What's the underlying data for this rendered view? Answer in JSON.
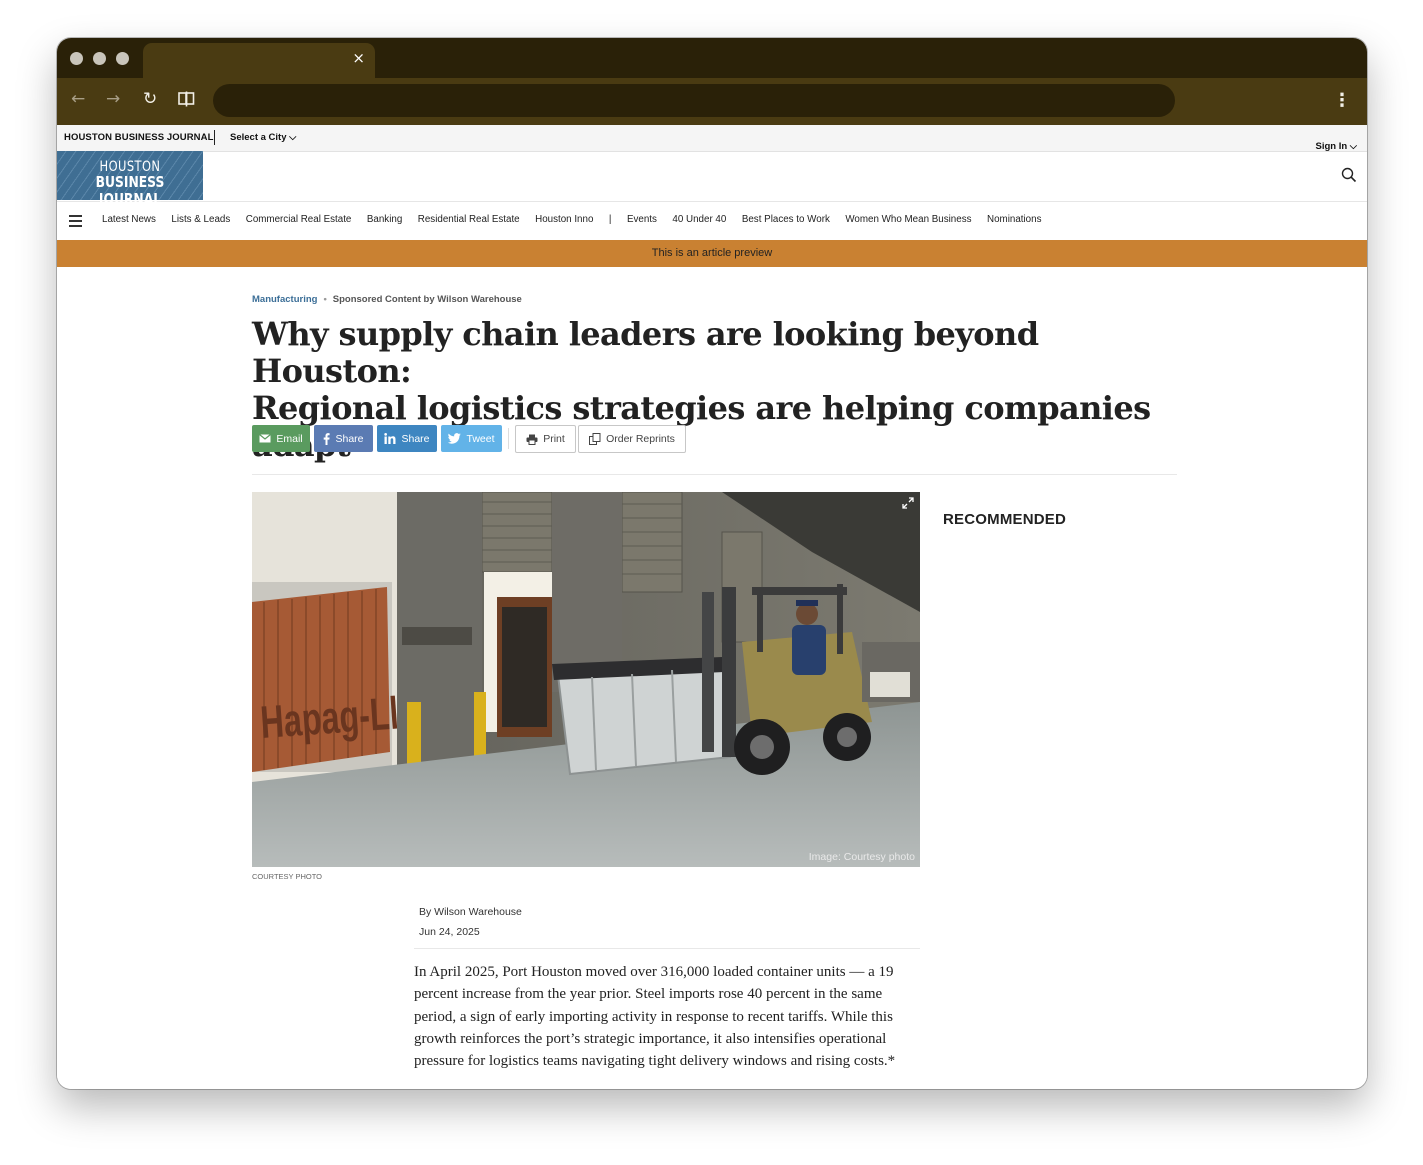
{
  "browser": {
    "tab_close": "×",
    "back": "←",
    "forward": "→",
    "reload": "↻",
    "menu": "⋮"
  },
  "topbar": {
    "brand": "HOUSTON BUSINESS JOURNAL",
    "city_select": "Select a City ⌵",
    "sign_in": "Sign In ⌵"
  },
  "header": {
    "logo_top": "HOUSTON",
    "logo_bottom": "BUSINESS JOURNAL"
  },
  "nav": {
    "items": [
      "Latest News",
      "Lists & Leads",
      "Commercial Real Estate",
      "Banking",
      "Residential Real Estate",
      "Houston Inno",
      "|",
      "Events",
      "40 Under 40",
      "Best Places to Work",
      "Women Who Mean Business",
      "Nominations"
    ]
  },
  "banner": {
    "text": "This is an article preview"
  },
  "article": {
    "category": "Manufacturing",
    "kicker_dot": "•",
    "sponsor": "Sponsored Content by Wilson Warehouse",
    "headline_line1": "Why supply chain leaders are looking beyond Houston:",
    "headline_line2": "Regional logistics strategies are helping companies adapt",
    "share": {
      "email": "Email",
      "facebook": "Share",
      "linkedin": "Share",
      "twitter": "Tweet",
      "print": "Print",
      "reprints": "Order Reprints"
    },
    "photo_overlay": "Image: Courtesy photo",
    "container_text": "Hapag-Lloyd",
    "photo_credit": "COURTESY PHOTO",
    "byline": "By Wilson Warehouse",
    "date": "Jun 24, 2025",
    "body": "In April 2025, Port Houston moved over 316,000 loaded container units — a 19 percent increase from the year prior. Steel imports rose 40 percent in the same period, a sign of early importing activity in response to recent tariffs. While this growth reinforces the port’s strategic importance, it also intensifies operational pressure for logistics teams navigating tight delivery windows and rising costs.*"
  },
  "sidebar": {
    "recommended": "RECOMMENDED"
  },
  "colors": {
    "chrome_dark": "#2a2108",
    "chrome_toolbar": "#4a3b12",
    "banner": "#c98132",
    "category_link": "#3b6e97",
    "email": "#5a9b5f",
    "facebook": "#5b7bb3",
    "linkedin": "#3e86c1",
    "twitter": "#62b3e8"
  }
}
